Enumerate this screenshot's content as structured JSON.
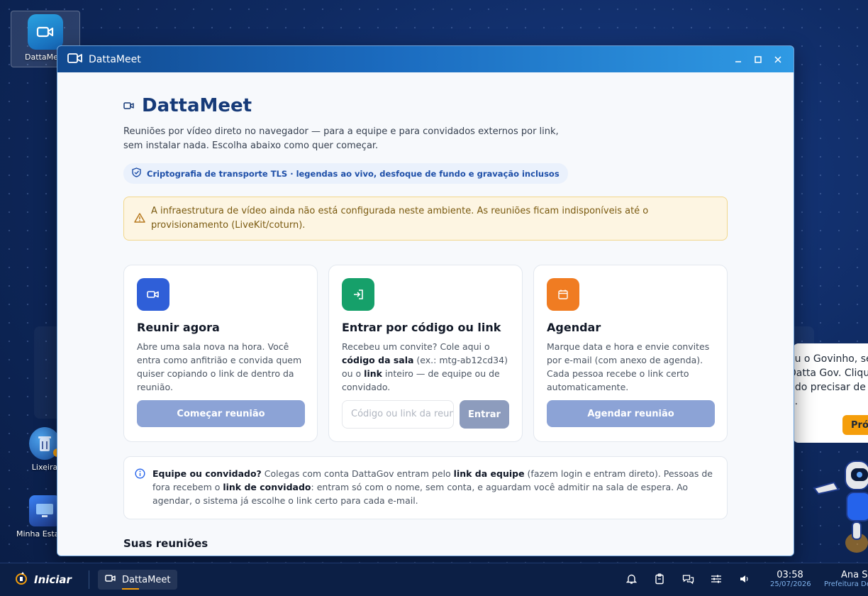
{
  "desktop": {
    "icons": [
      {
        "label": "DattaMeet"
      },
      {
        "label": "Lixeira"
      },
      {
        "label": "Minha Estação"
      }
    ]
  },
  "popup": {
    "lines": [
      "ou o Govinho, seu",
      "Datta Gov. Cliqu",
      "ndo precisar de",
      "a."
    ],
    "button": "Próx"
  },
  "window": {
    "title": "DattaMeet",
    "heading": "DattaMeet",
    "intro": "Reuniões por vídeo direto no navegador — para a equipe e para convidados externos por link, sem instalar nada. Escolha abaixo como quer começar.",
    "chip": "Criptografia de transporte TLS · legendas ao vivo, desfoque de fundo e gravação inclusos",
    "warning": "A infraestrutura de vídeo ainda não está configurada neste ambiente. As reuniões ficam indisponíveis até o provisionamento (LiveKit/coturn).",
    "cards": [
      {
        "title": "Reunir agora",
        "desc": "Abre uma sala nova na hora. Você entra como anfitrião e convida quem quiser copiando o link de dentro da reunião.",
        "button": "Começar reunião",
        "color": "#2f5fd8"
      },
      {
        "title": "Entrar por código ou link",
        "desc_1": "Recebeu um convite? Cole aqui o ",
        "desc_b1": "código da sala",
        "desc_2": " (ex.: mtg-ab12cd34) ou o ",
        "desc_b2": "link",
        "desc_3": " inteiro — de equipe ou de convidado.",
        "placeholder": "Código ou link da reunião",
        "button": "Entrar",
        "color": "#16a06a"
      },
      {
        "title": "Agendar",
        "desc": "Marque data e hora e envie convites por e-mail (com anexo de agenda). Cada pessoa recebe o link certo automaticamente.",
        "button": "Agendar reunião",
        "color": "#f07c22"
      }
    ],
    "info": {
      "b1": "Equipe ou convidado?",
      "t1": " Colegas com conta DattaGov entram pelo ",
      "b2": "link da equipe",
      "t2": " (fazem login e entram direto). Pessoas de fora recebem o ",
      "b3": "link de convidado",
      "t3": ": entram só com o nome, sem conta, e aguardam você admitir na sala de espera. Ao agendar, o sistema já escolhe o link certo para cada e-mail."
    },
    "section_title": "Suas reuniões"
  },
  "taskbar": {
    "start": "Iniciar",
    "app": "DattaMeet",
    "time": "03:58",
    "date": "25/07/2026",
    "user": "Ana Si",
    "org": "Prefeitura De"
  }
}
